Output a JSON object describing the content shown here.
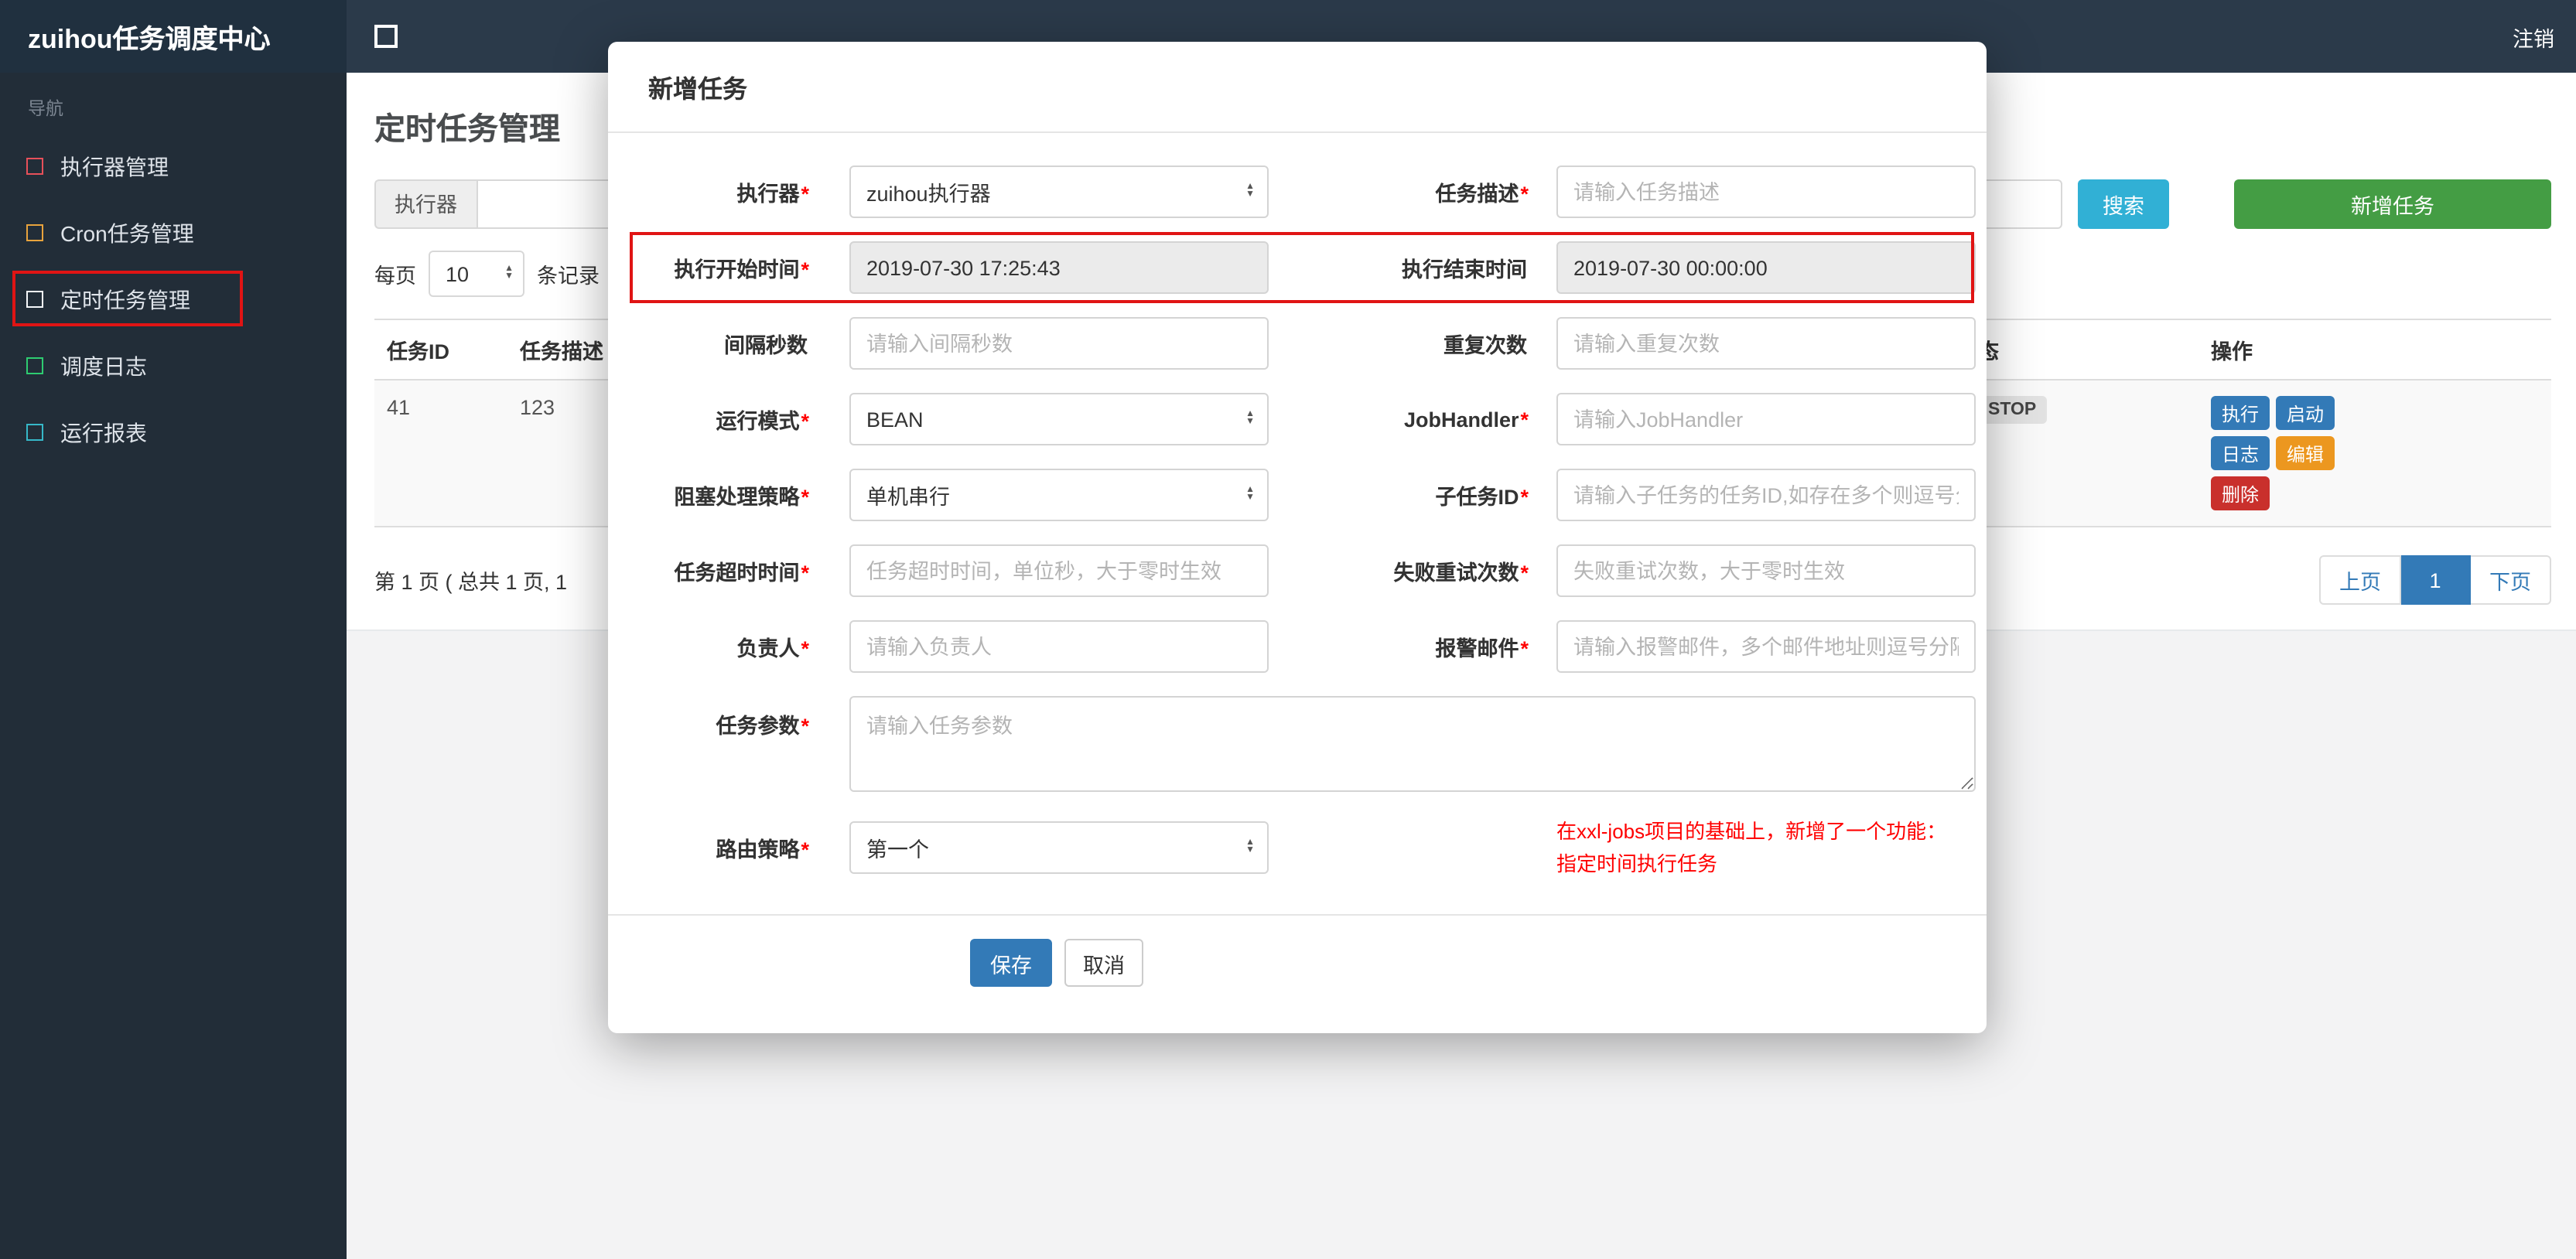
{
  "colors": {
    "primary": "#337ab7",
    "info": "#31b0d5",
    "success": "#449d44",
    "warning": "#ec971f",
    "danger": "#c9302c",
    "annotation": "#e01414"
  },
  "topbar": {
    "brand": "zuihou任务调度中心",
    "logout": "注销"
  },
  "sidebar": {
    "nav_label": "导航",
    "items": [
      {
        "label": "执行器管理",
        "color": "#e7505a"
      },
      {
        "label": "Cron任务管理",
        "color": "#e8a33d"
      },
      {
        "label": "定时任务管理",
        "color": "#f5f7fa",
        "active": true
      },
      {
        "label": "调度日志",
        "color": "#2ecc71"
      },
      {
        "label": "运行报表",
        "color": "#36b8c8"
      }
    ]
  },
  "page": {
    "title": "定时任务管理",
    "filter": {
      "executor_label": "执行器",
      "search_button": "搜索",
      "add_button": "新增任务"
    },
    "per_page": {
      "prefix": "每页",
      "value": "10",
      "suffix": "条记录"
    },
    "table": {
      "headers": [
        "任务ID",
        "任务描述",
        "状态",
        "操作"
      ],
      "row": {
        "id": "41",
        "desc": "123",
        "status": "STOP",
        "actions": {
          "run": "执行",
          "start": "启动",
          "log": "日志",
          "edit": "编辑",
          "del": "删除"
        }
      }
    },
    "pagination": {
      "summary": "第 1 页 ( 总共 1 页, 1",
      "prev": "上页",
      "current": "1",
      "next": "下页"
    }
  },
  "modal": {
    "title": "新增任务",
    "fields": {
      "executor": {
        "label": "执行器",
        "required": "*",
        "value": "zuihou执行器"
      },
      "job_desc": {
        "label": "任务描述",
        "required": "*",
        "placeholder": "请输入任务描述"
      },
      "start_time": {
        "label": "执行开始时间",
        "required": "*",
        "value": "2019-07-30 17:25:43"
      },
      "end_time": {
        "label": "执行结束时间",
        "value": "2019-07-30 00:00:00"
      },
      "interval": {
        "label": "间隔秒数",
        "placeholder": "请输入间隔秒数"
      },
      "repeat": {
        "label": "重复次数",
        "placeholder": "请输入重复次数"
      },
      "glue_type": {
        "label": "运行模式",
        "required": "*",
        "value": "BEAN"
      },
      "job_handler": {
        "label": "JobHandler",
        "required": "*",
        "placeholder": "请输入JobHandler"
      },
      "block_strategy": {
        "label": "阻塞处理策略",
        "required": "*",
        "value": "单机串行"
      },
      "child_job": {
        "label": "子任务ID",
        "required": "*",
        "placeholder": "请输入子任务的任务ID,如存在多个则逗号分隔"
      },
      "timeout": {
        "label": "任务超时时间",
        "required": "*",
        "placeholder": "任务超时时间，单位秒，大于零时生效"
      },
      "fail_retry": {
        "label": "失败重试次数",
        "required": "*",
        "placeholder": "失败重试次数，大于零时生效"
      },
      "author": {
        "label": "负责人",
        "required": "*",
        "placeholder": "请输入负责人"
      },
      "alarm_email": {
        "label": "报警邮件",
        "required": "*",
        "placeholder": "请输入报警邮件，多个邮件地址则逗号分隔"
      },
      "job_param": {
        "label": "任务参数",
        "required": "*",
        "placeholder": "请输入任务参数"
      },
      "route_strategy": {
        "label": "路由策略",
        "required": "*",
        "value": "第一个"
      }
    },
    "note": {
      "line1": "在xxl-jobs项目的基础上，新增了一个功能：",
      "line2": "指定时间执行任务"
    },
    "buttons": {
      "save": "保存",
      "cancel": "取消"
    }
  }
}
